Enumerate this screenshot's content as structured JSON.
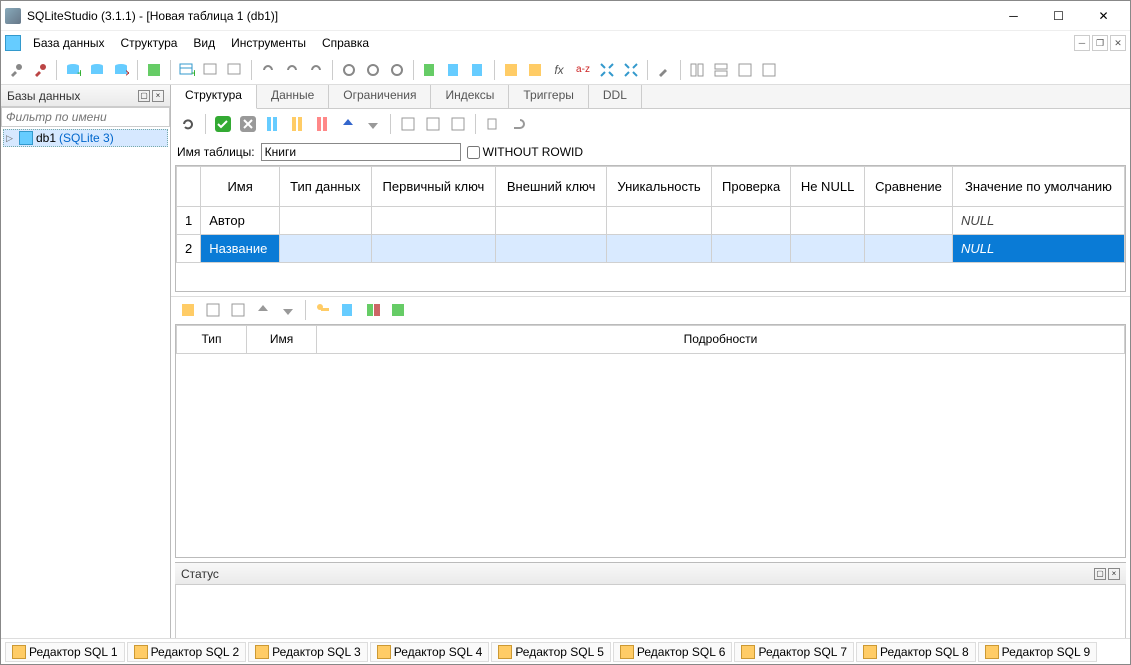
{
  "window": {
    "title": "SQLiteStudio (3.1.1) - [Новая таблица 1 (db1)]"
  },
  "menu": {
    "items": [
      "База данных",
      "Структура",
      "Вид",
      "Инструменты",
      "Справка"
    ]
  },
  "sidebar": {
    "title": "Базы данных",
    "filter_placeholder": "Фильтр по имени",
    "db_name": "db1",
    "db_type": " (SQLite 3)"
  },
  "tabs": {
    "items": [
      "Структура",
      "Данные",
      "Ограничения",
      "Индексы",
      "Триггеры",
      "DDL"
    ],
    "active": 0
  },
  "table": {
    "name_label": "Имя таблицы:",
    "name_value": "Книги",
    "without_rowid": "WITHOUT ROWID"
  },
  "columns": {
    "headers": [
      "Имя",
      "Тип данных",
      "Первичный ключ",
      "Внешний ключ",
      "Уникальность",
      "Проверка",
      "Не NULL",
      "Сравнение",
      "Значение по умолчанию"
    ],
    "rows": [
      {
        "n": "1",
        "name": "Автор",
        "type": "",
        "pk": "",
        "fk": "",
        "unique": "",
        "check": "",
        "notnull": "",
        "collate": "",
        "default": "NULL"
      },
      {
        "n": "2",
        "name": "Название",
        "type": "",
        "pk": "",
        "fk": "",
        "unique": "",
        "check": "",
        "notnull": "",
        "collate": "",
        "default": "NULL"
      }
    ]
  },
  "details": {
    "headers": [
      "Тип",
      "Имя",
      "Подробности"
    ]
  },
  "status": {
    "title": "Статус"
  },
  "bottom": {
    "tabs": [
      "Редактор SQL 1",
      "Редактор SQL 2",
      "Редактор SQL 3",
      "Редактор SQL 4",
      "Редактор SQL 5",
      "Редактор SQL 6",
      "Редактор SQL 7",
      "Редактор SQL 8",
      "Редактор SQL 9"
    ]
  }
}
